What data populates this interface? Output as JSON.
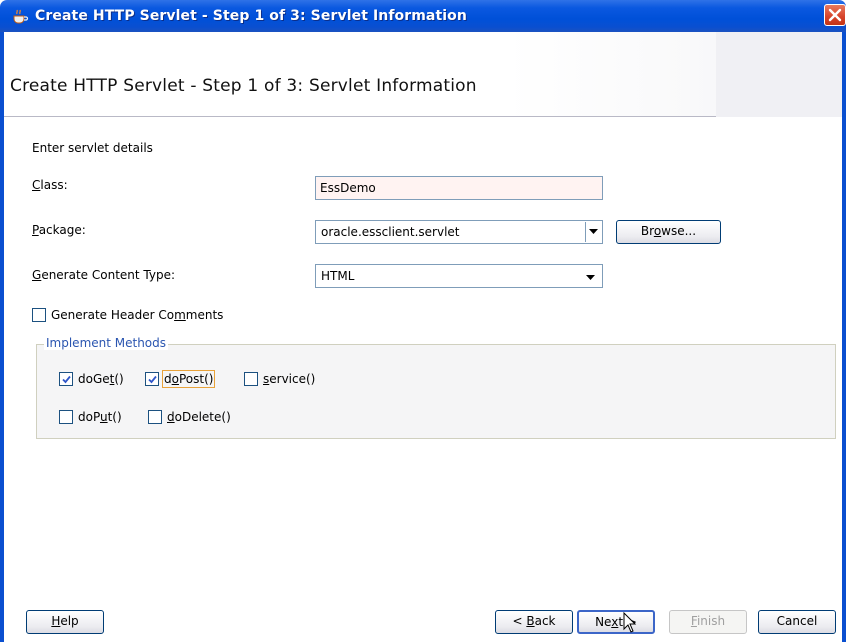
{
  "window": {
    "title": "Create HTTP Servlet - Step 1 of 3: Servlet Information",
    "heading": "Create HTTP Servlet - Step 1 of 3: Servlet Information"
  },
  "form": {
    "intro": "Enter servlet details",
    "class_label_mnemonic": "C",
    "class_label_rest": "lass:",
    "class_value": "EssDemo",
    "package_label_mnemonic": "P",
    "package_label_rest": "ackage:",
    "package_value": "oracle.essclient.servlet",
    "browse_label_pre": "Br",
    "browse_label_mnemonic": "o",
    "browse_label_post": "wse...",
    "content_type_label_mnemonic": "G",
    "content_type_label_rest": "enerate Content Type:",
    "content_type_value": "HTML",
    "header_comments_pre": "Generate Header Co",
    "header_comments_mnemonic": "m",
    "header_comments_post": "ments"
  },
  "methods": {
    "legend": "Implement Methods",
    "doget_pre": "doGe",
    "doget_mnemonic": "t",
    "doget_post": "()",
    "dopost_pre": "d",
    "dopost_mnemonic": "o",
    "dopost_post": "Post()",
    "service_pre": "",
    "service_mnemonic": "s",
    "service_post": "ervice()",
    "doput_pre": "doP",
    "doput_mnemonic": "u",
    "doput_post": "t()",
    "dodelete_pre": "",
    "dodelete_mnemonic": "d",
    "dodelete_post": "oDelete()"
  },
  "buttons": {
    "help_mnemonic": "H",
    "help_rest": "elp",
    "back_pre": "< ",
    "back_mnemonic": "B",
    "back_post": "ack",
    "next_pre": "Ne",
    "next_mnemonic": "x",
    "next_post": "t >",
    "finish_mnemonic": "F",
    "finish_rest": "inish",
    "cancel": "Cancel"
  },
  "colors": {
    "titlebar": "#0a58e0",
    "input_bg": "#fff3f2",
    "legend": "#2a55b0",
    "focus": "#e8a23a"
  }
}
